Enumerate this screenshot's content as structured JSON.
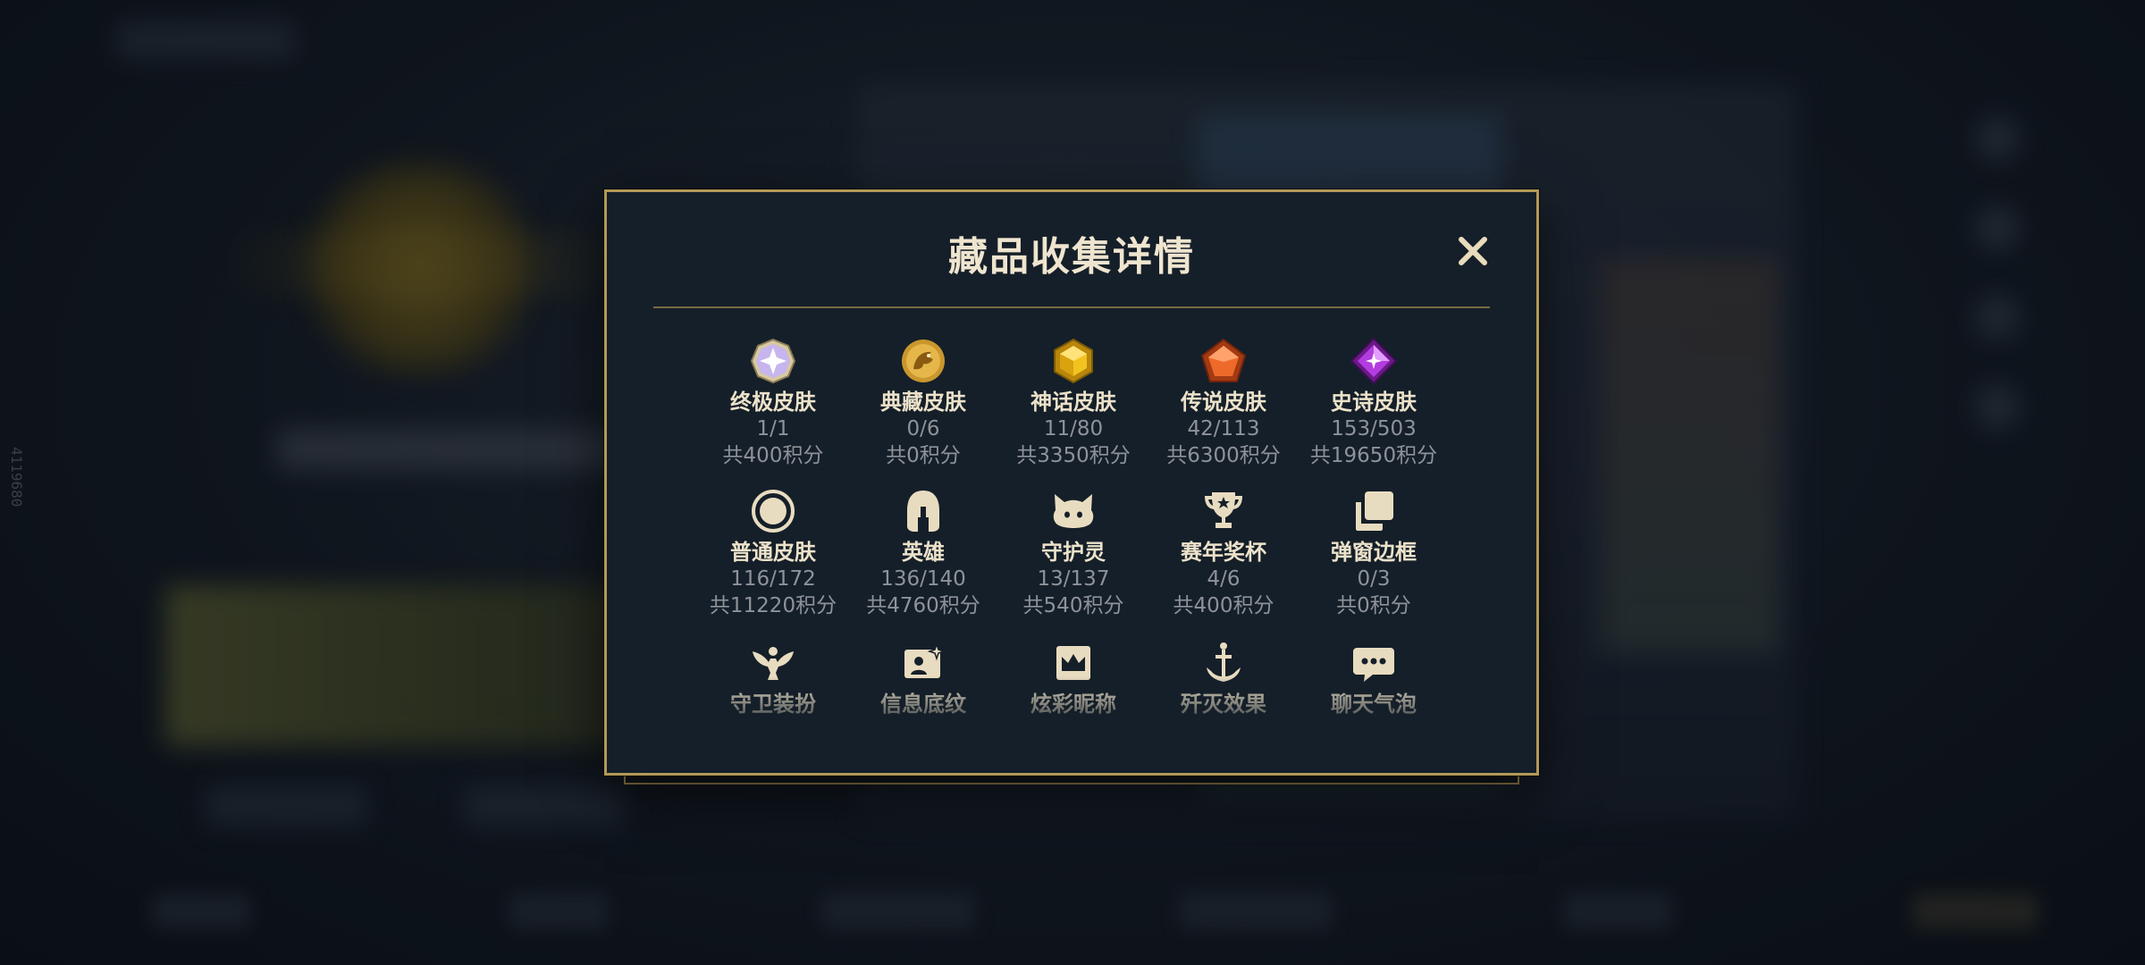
{
  "background": {
    "side_id": "4119680"
  },
  "modal": {
    "title": "藏品收集详情",
    "close_icon": "close-icon",
    "accent_color": "#b39958",
    "items": [
      {
        "name": "终极皮肤",
        "count": "1/1",
        "points": "共400积分",
        "icon": "ultimate-skin-icon"
      },
      {
        "name": "典藏皮肤",
        "count": "0/6",
        "points": "共0积分",
        "icon": "collection-skin-icon"
      },
      {
        "name": "神话皮肤",
        "count": "11/80",
        "points": "共3350积分",
        "icon": "mythic-skin-icon"
      },
      {
        "name": "传说皮肤",
        "count": "42/113",
        "points": "共6300积分",
        "icon": "legendary-skin-icon"
      },
      {
        "name": "史诗皮肤",
        "count": "153/503",
        "points": "共19650积分",
        "icon": "epic-skin-icon"
      },
      {
        "name": "普通皮肤",
        "count": "116/172",
        "points": "共11220积分",
        "icon": "normal-skin-icon"
      },
      {
        "name": "英雄",
        "count": "136/140",
        "points": "共4760积分",
        "icon": "helmet-icon"
      },
      {
        "name": "守护灵",
        "count": "13/137",
        "points": "共540积分",
        "icon": "guardian-spirit-icon"
      },
      {
        "name": "赛年奖杯",
        "count": "4/6",
        "points": "共400积分",
        "icon": "trophy-icon"
      },
      {
        "name": "弹窗边框",
        "count": "0/3",
        "points": "共0积分",
        "icon": "frame-icon"
      }
    ],
    "partial_items": [
      {
        "name": "守卫装扮",
        "icon": "ward-skin-icon"
      },
      {
        "name": "信息底纹",
        "icon": "info-card-icon"
      },
      {
        "name": "炫彩昵称",
        "icon": "crown-nameplate-icon"
      },
      {
        "name": "歼灭效果",
        "icon": "anchor-icon"
      },
      {
        "name": "聊天气泡",
        "icon": "chat-bubble-icon"
      }
    ]
  }
}
